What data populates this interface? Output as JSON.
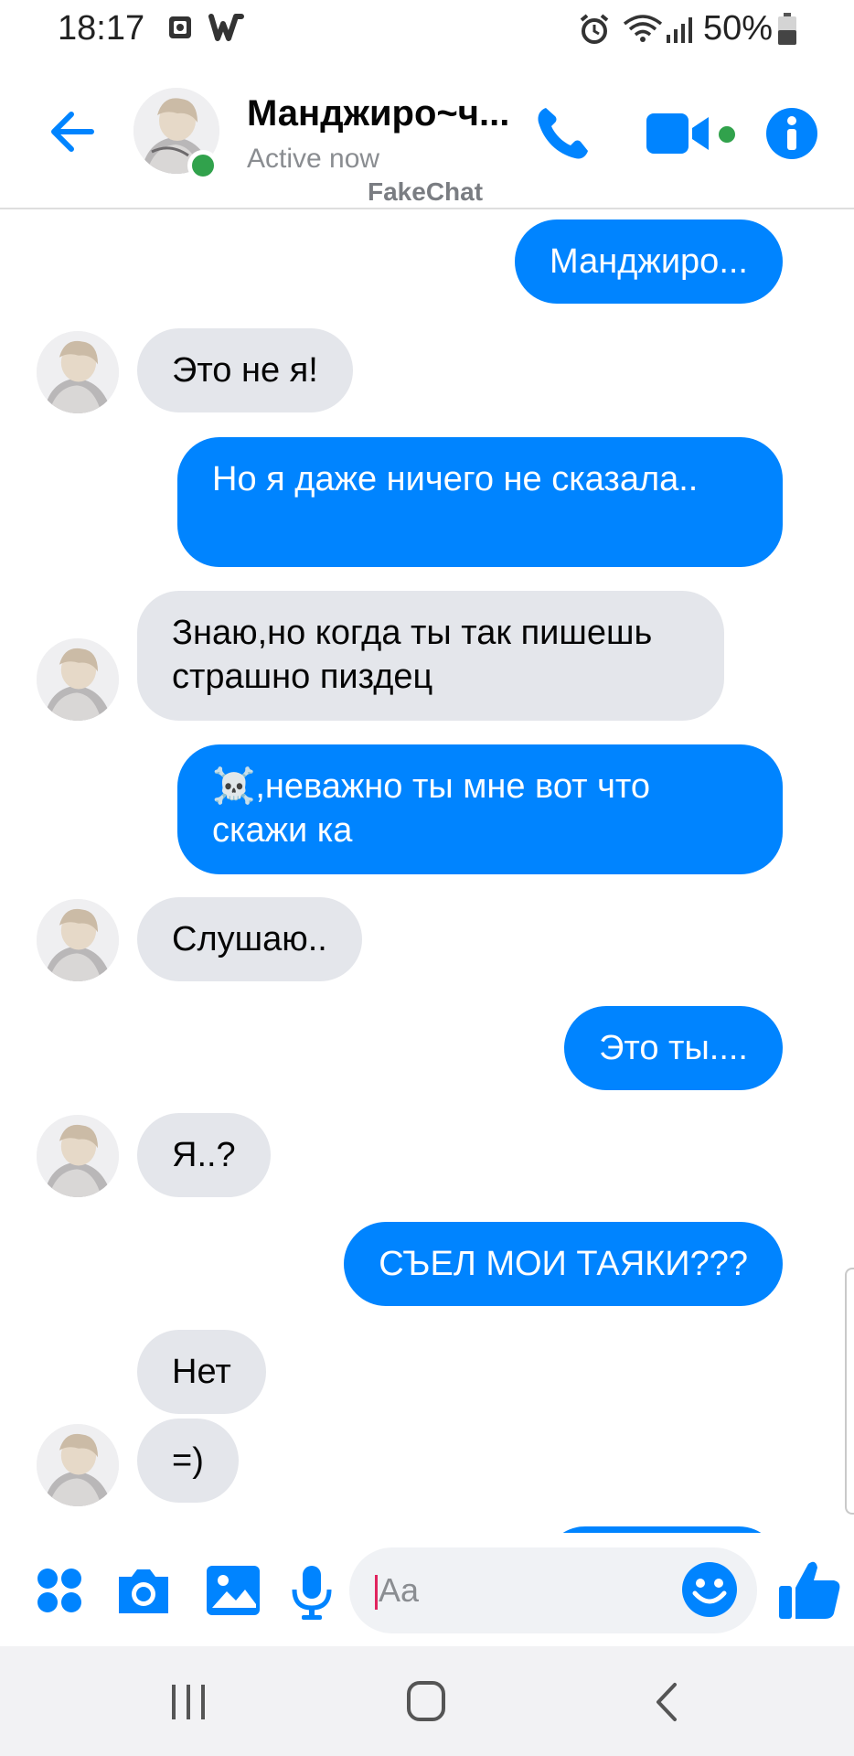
{
  "status_bar": {
    "time": "18:17",
    "battery": "50%",
    "icons": [
      "gallery-icon",
      "w-app-icon",
      "alarm-icon",
      "wifi-icon",
      "signal-icon",
      "battery-icon"
    ]
  },
  "header": {
    "contact_name": "Манджиро~ч...",
    "contact_status": "Active now",
    "watermark": "FakeChat"
  },
  "messages": [
    {
      "from": "me",
      "text": "Манджиро..."
    },
    {
      "from": "them",
      "text": "Это не я!"
    },
    {
      "from": "me",
      "text": "Но я даже ничего не сказала.."
    },
    {
      "from": "them",
      "text": "Знаю,но когда ты так пишешь страшно пиздец"
    },
    {
      "from": "me",
      "text": "☠️,неважно ты мне вот что скажи ка"
    },
    {
      "from": "them",
      "text": "Слушаю.."
    },
    {
      "from": "me",
      "text": "Это ты...."
    },
    {
      "from": "them",
      "text": "Я..?"
    },
    {
      "from": "me",
      "text": "СЪЕЛ МОИ ТАЯКИ???"
    },
    {
      "from": "them",
      "text": "Нет"
    },
    {
      "from": "them",
      "text": "=)"
    }
  ],
  "composer": {
    "placeholder": "Aa"
  },
  "colors": {
    "accent": "#0084ff",
    "incoming_bubble": "#e4e6eb",
    "online": "#31a24c"
  }
}
